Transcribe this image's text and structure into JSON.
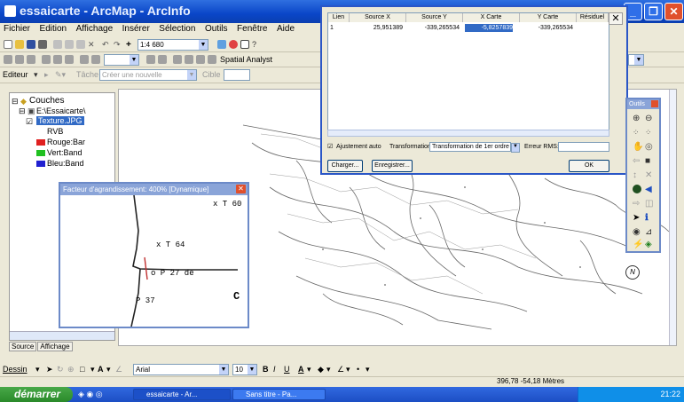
{
  "window": {
    "title": "essaicarte - ArcMap - ArcInfo"
  },
  "menu": [
    "Fichier",
    "Edition",
    "Affichage",
    "Insérer",
    "Sélection",
    "Outils",
    "Fenêtre",
    "Aide"
  ],
  "toolbar": {
    "scale": "1:4 680",
    "spatial_analyst": "Spatial Analyst",
    "editor": "Editeur",
    "task_label": "Tâche",
    "task_value": "Créer une nouvelle",
    "target_label": "Cible"
  },
  "toc": {
    "root": "Couches",
    "folder": "E:\\Essaicarte\\",
    "layer": "Texture.JPG",
    "rvb": "RVB",
    "bands": [
      {
        "label": "Rouge:Bar",
        "color": "#e02020"
      },
      {
        "label": "Vert:Band",
        "color": "#20c020"
      },
      {
        "label": "Bleu:Band",
        "color": "#2020d0"
      }
    ],
    "tabs": [
      "Source",
      "Affichage"
    ]
  },
  "magnifier": {
    "title": "Facteur d'agrandissement: 400% [Dynamique]",
    "close": "✕",
    "labels": [
      "x T 60",
      "x T 64",
      "o P 27 de",
      "P 37"
    ],
    "corner": "C"
  },
  "links_dialog": {
    "columns": [
      "Lien",
      "Source X",
      "Source Y",
      "X Carte",
      "Y Carte",
      "Résiduel"
    ],
    "rows": [
      {
        "lien": "1",
        "source_x": "25,951389",
        "source_y": "-339,265534",
        "x_carte": "-5,8257839",
        "y_carte": "-339,265534",
        "residuel": ""
      }
    ],
    "auto_adjust": "Ajustement auto",
    "transformation_label": "Transformation:",
    "transformation_value": "Transformation de 1er ordre",
    "rms_label": "Erreur RMS:",
    "rms_value": "",
    "btn_load": "Charger...",
    "btn_save": "Enregistrer...",
    "btn_ok": "OK",
    "close": "✕"
  },
  "outils": {
    "title": "Outils"
  },
  "drawing": {
    "label": "Dessin",
    "font": "Arial",
    "size": "10",
    "bold": "B",
    "italic": "I",
    "underline": "U"
  },
  "status": {
    "coords": "396,78  -54,18 Mètres"
  },
  "taskbar": {
    "start": "démarrer",
    "tasks": [
      "essaicarte - Ar...",
      "Sans titre - Pa..."
    ],
    "clock": "21:22"
  },
  "map": {
    "north": "N"
  }
}
